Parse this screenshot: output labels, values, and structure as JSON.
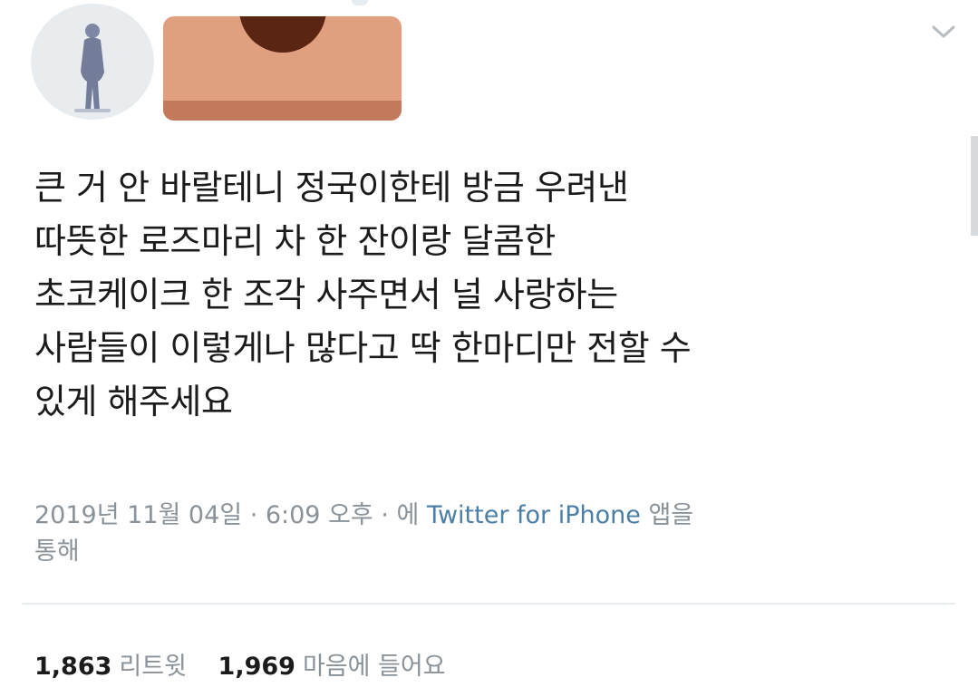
{
  "tweet": {
    "text_lines": [
      "큰 거 안 바랄테니 정국이한테 방금 우려낸",
      "따뜻한 로즈마리 차 한 잔이랑 달콤한",
      "초코케이크 한 조각 사주면서 널 사랑하는",
      "사람들이 이렇게나 많다고 딱 한마디만 전할 수",
      "있게 해주세요"
    ],
    "meta": {
      "line1_prefix": "2019년 11월 04일 · 6:09 오후 · 에 ",
      "source": "Twitter for iPhone",
      "line1_suffix": " 앱을",
      "line2": "통해"
    },
    "stats": {
      "retweets_count": "1,863",
      "retweets_label": "리트윗",
      "likes_count": "1,969",
      "likes_label": "마음에 들어요"
    }
  },
  "icons": {
    "menu": "chevron-down-icon",
    "avatar": "avatar-figure"
  },
  "colors": {
    "redaction_main": "#e0a080",
    "redaction_band": "#c27a5c",
    "redaction_blob": "#5a2613",
    "source_link": "#4b7fa6",
    "meta_text": "#8a9299"
  }
}
